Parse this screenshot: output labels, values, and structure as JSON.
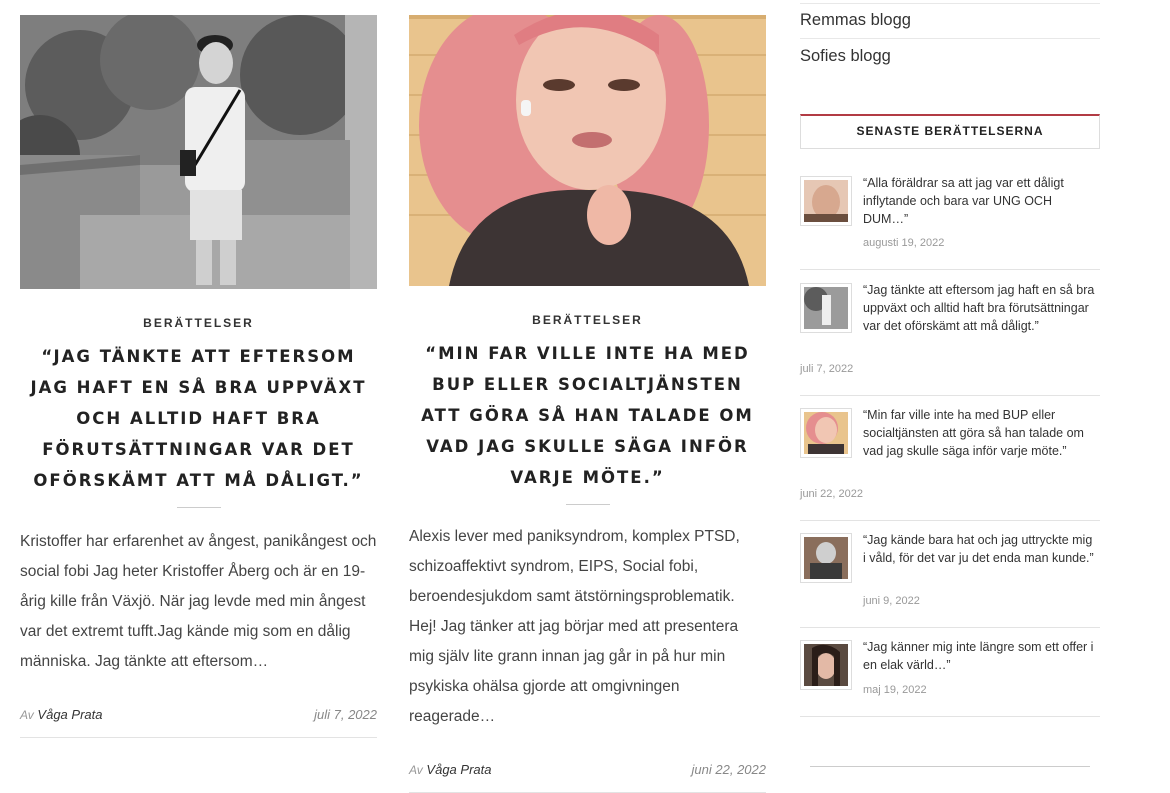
{
  "posts": [
    {
      "category": "BERÄTTELSER",
      "title": "“JAG TÄNKTE ATT EFTERSOM JAG HAFT EN SÅ BRA UPPVÄXT OCH ALLTID HAFT BRA FÖRUTSÄTTNINGAR VAR DET OFÖRSKÄMT ATT MÅ DÅLIGT.”",
      "excerpt": "Kristoffer har erfarenhet av ångest, panikångest och social fobi Jag heter Kristoffer Åberg och är en 19-årig kille från Växjö. När jag levde med min ångest var det extremt tufft.Jag kände mig som en dålig människa. Jag tänkte att eftersom…",
      "by": "Av",
      "author": "Våga Prata",
      "date": "juli 7, 2022"
    },
    {
      "category": "BERÄTTELSER",
      "title": "“MIN FAR VILLE INTE HA MED BUP ELLER SOCIALTJÄNSTEN ATT GÖRA SÅ HAN TALADE OM VAD JAG SKULLE SÄGA INFÖR VARJE MÖTE.”",
      "excerpt": "Alexis lever med paniksyndrom, komplex PTSD, schizoaffektivt syndrom, EIPS, Social fobi, beroendesjukdom samt ätstörningsproblematik. Hej! Jag tänker att jag börjar med att presentera mig själv lite grann innan jag går in på hur min psykiska ohälsa gjorde att omgivningen reagerade…",
      "by": "Av",
      "author": "Våga Prata",
      "date": "juni 22, 2022"
    }
  ],
  "sidebar": {
    "blogs": [
      "Remmas blogg",
      "Sofies blogg"
    ],
    "recent_title": "SENASTE BERÄTTELSERNA",
    "recent": [
      {
        "title": "“Alla föräldrar sa att jag var ett dåligt inflytande och bara var UNG OCH DUM…”",
        "date": "augusti 19, 2022"
      },
      {
        "title": "“Jag tänkte att eftersom jag haft en så bra uppväxt och alltid haft bra förutsättningar var det oförskämt att må dåligt.”",
        "date": "juli 7, 2022"
      },
      {
        "title": "“Min far ville inte ha med BUP eller socialtjänsten att göra så han talade om vad jag skulle säga inför varje möte.”",
        "date": "juni 22, 2022"
      },
      {
        "title": "“Jag kände bara hat och jag uttryckte mig i våld, för det var ju det enda man kunde.”",
        "date": "juni 9, 2022"
      },
      {
        "title": "“Jag känner mig inte längre som ett offer i en elak värld…”",
        "date": "maj 19, 2022"
      }
    ]
  }
}
